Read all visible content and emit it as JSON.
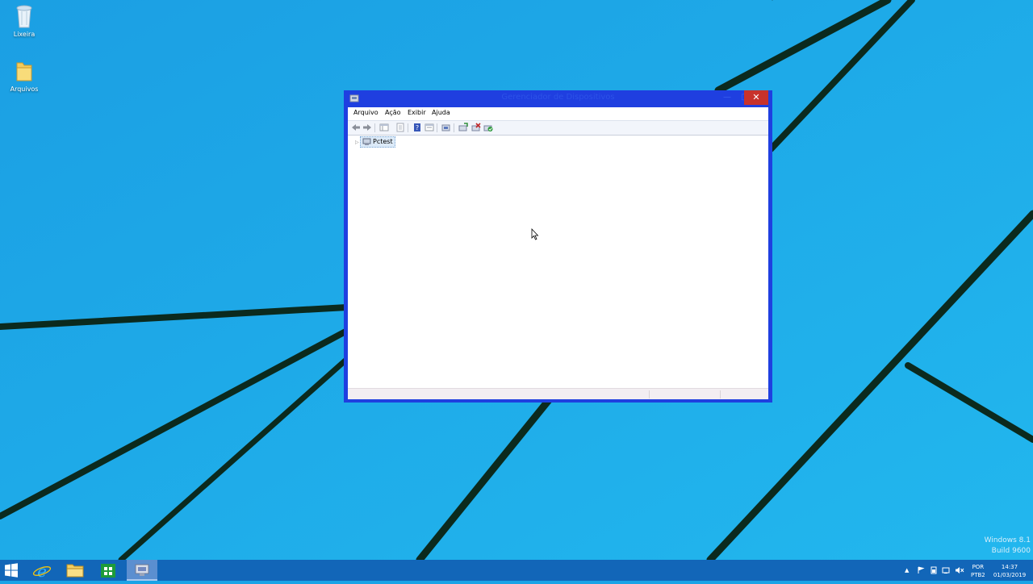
{
  "desktop": {
    "icons": [
      {
        "label": "Lixeira",
        "icon": "recycle-bin-icon"
      },
      {
        "label": "Arquivos",
        "icon": "folder-icon"
      }
    ],
    "watermark": {
      "line1": "Windows 8.1",
      "line2": "Build 9600"
    }
  },
  "window": {
    "title": "Gerenciador de Dispositivos",
    "icon": "device-manager-icon",
    "controls": {
      "minimize": "—",
      "maximize": "□",
      "close": "✕"
    },
    "menu": [
      "Arquivo",
      "Ação",
      "Exibir",
      "Ajuda"
    ],
    "toolbar": [
      "back-icon",
      "forward-icon",
      "show-hide-tree-icon",
      "properties-icon",
      "help-icon",
      "view-icon",
      "update-driver-icon",
      "scan-hardware-icon",
      "uninstall-icon",
      "enable-device-icon"
    ],
    "tree": {
      "root_label": "Pctest"
    }
  },
  "taskbar": {
    "buttons": [
      "start-icon",
      "internet-explorer-icon",
      "file-explorer-icon",
      "store-icon",
      "device-manager-icon"
    ],
    "tray": {
      "language_line1": "POR",
      "language_line2": "PTB2",
      "time": "14:37",
      "date": "01/03/2019"
    }
  },
  "colors": {
    "desktop_bg": "#1aa3e6",
    "window_frame": "#1f3fe0",
    "close_button": "#c8322b",
    "taskbar": "#1266b8"
  }
}
